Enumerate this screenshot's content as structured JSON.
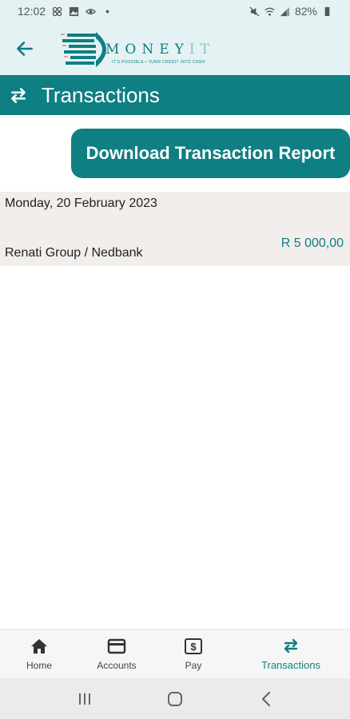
{
  "status_bar": {
    "time": "12:02",
    "battery": "82%",
    "icons_left": [
      "grid-icon",
      "image-icon",
      "eye-icon",
      "dot-icon"
    ],
    "icons_right": [
      "mute-icon",
      "wifi-icon",
      "signal-icon",
      "battery-icon"
    ]
  },
  "brand": {
    "logo_word_main": "MONEY",
    "logo_word_accent": "IT",
    "logo_tagline": "IT'S POSSIBLE • TURN CREDIT INTO CASH",
    "back_icon": "arrow-left-icon"
  },
  "header": {
    "title": "Transactions",
    "icon": "swap-icon"
  },
  "actions": {
    "download_label": "Download Transaction Report"
  },
  "transactions": {
    "date": "Monday, 20 February 2023",
    "items": [
      {
        "description": "Renati Group / Nedbank",
        "amount": "R 5 000,00"
      }
    ]
  },
  "bottom_nav": {
    "items": [
      {
        "label": "Home",
        "icon": "home-icon"
      },
      {
        "label": "Accounts",
        "icon": "card-icon"
      },
      {
        "label": "Pay",
        "icon": "dollar-bill-icon"
      },
      {
        "label": "Transactions",
        "icon": "swap-icon",
        "active": true
      }
    ]
  },
  "colors": {
    "primary": "#0e7f82",
    "header_bg": "#e4f2f4",
    "section_bg": "#f1eeeb"
  }
}
